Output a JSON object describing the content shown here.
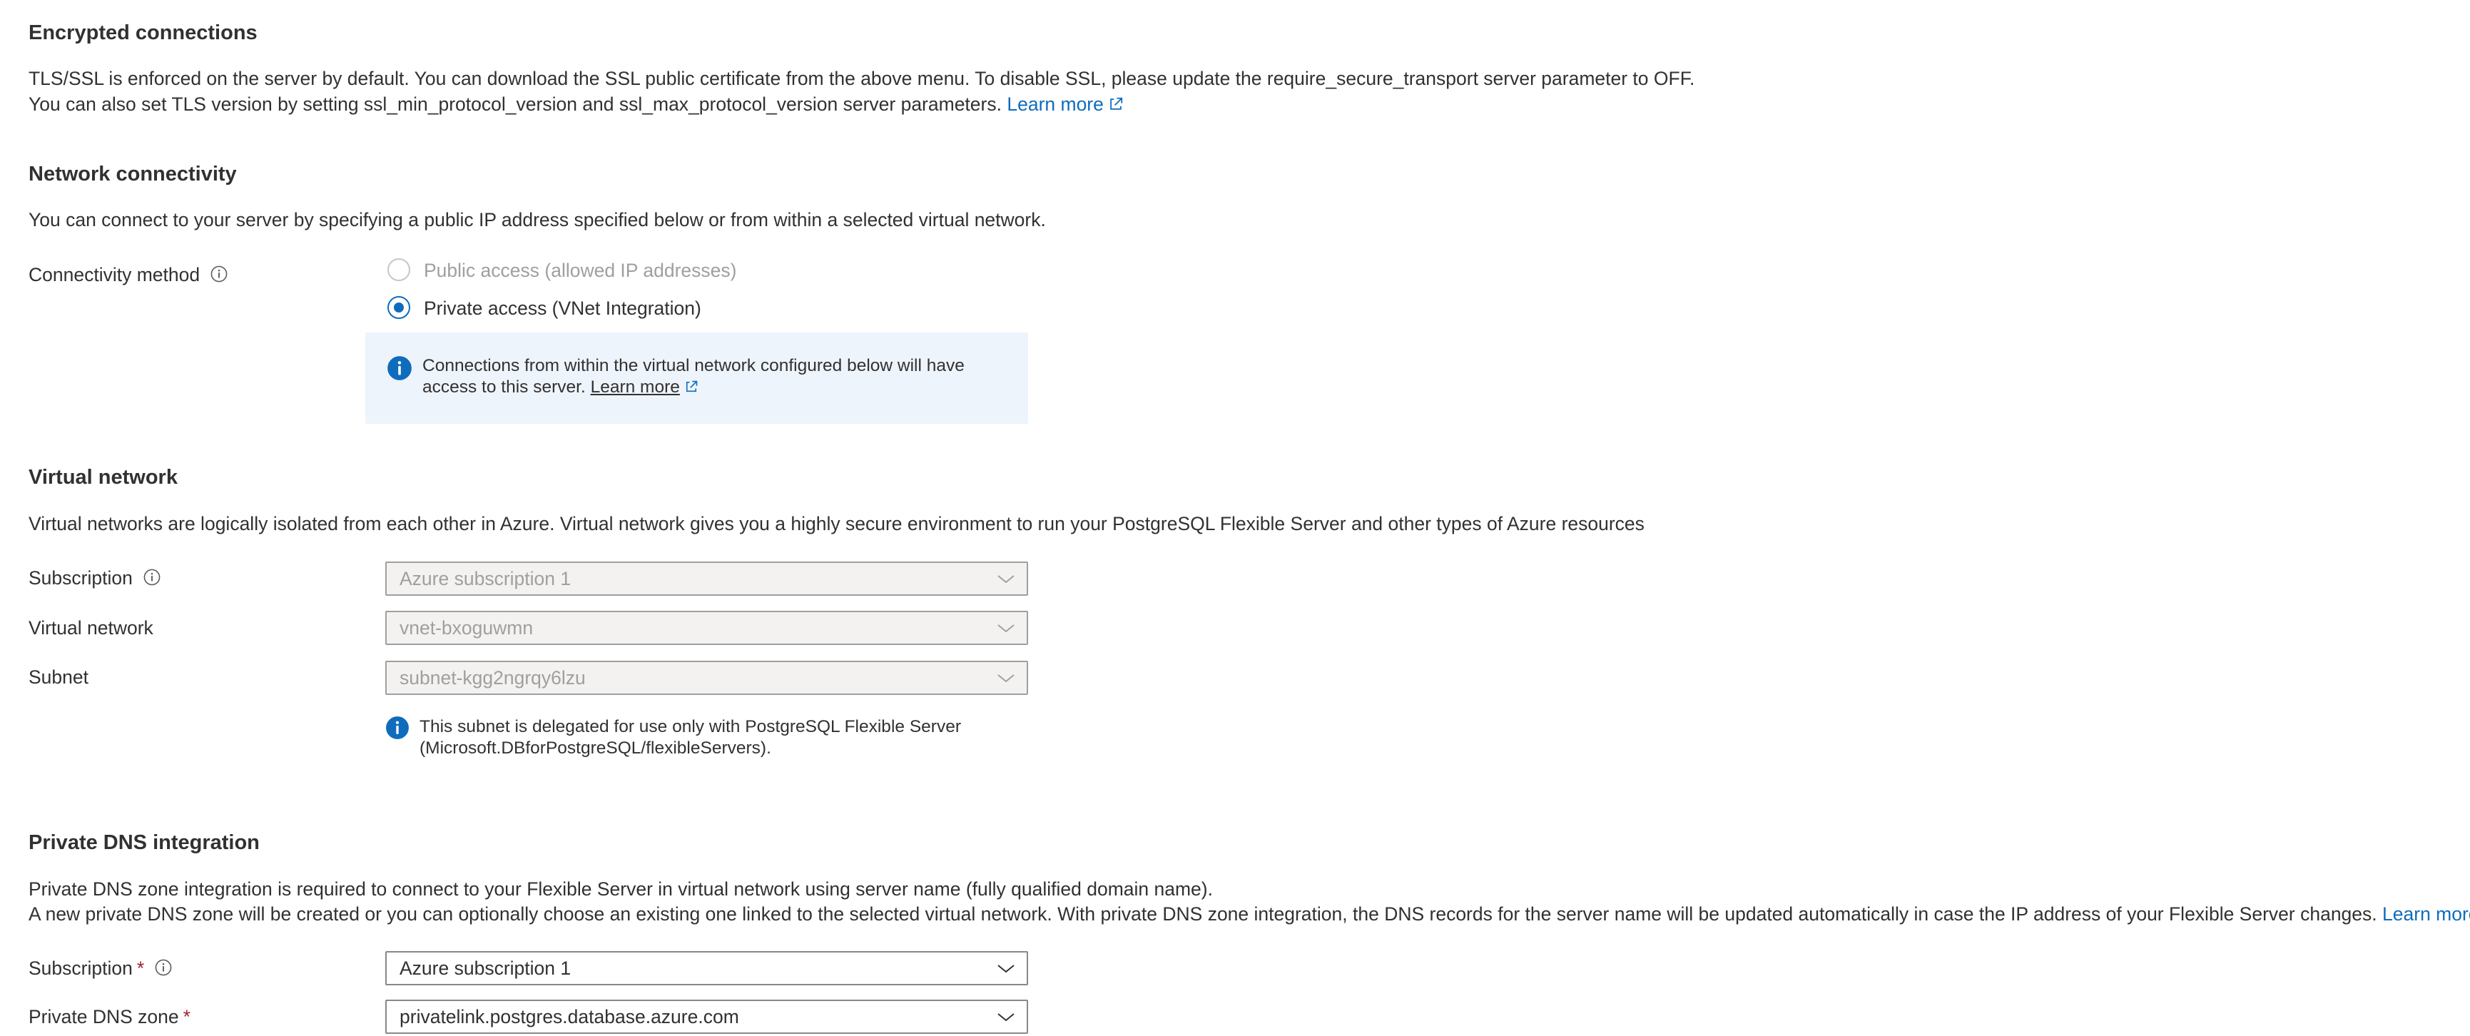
{
  "encrypted": {
    "heading": "Encrypted connections",
    "line1": "TLS/SSL is enforced on the server by default. You can download the SSL public certificate from the above menu. To disable SSL, please update the require_secure_transport server parameter to OFF.",
    "line2": "You can also set TLS version by setting ssl_min_protocol_version and ssl_max_protocol_version server parameters.",
    "learn_more": "Learn more"
  },
  "network": {
    "heading": "Network connectivity",
    "description": "You can connect to your server by specifying a public IP address specified below or from within a selected virtual network.",
    "method_label": "Connectivity method",
    "options": [
      {
        "label": "Public access (allowed IP addresses)",
        "selected": false,
        "disabled": true
      },
      {
        "label": "Private access (VNet Integration)",
        "selected": true,
        "disabled": false
      }
    ],
    "info_line1": "Connections from within the virtual network configured below will have",
    "info_line2": "access to this server.",
    "info_link": "Learn more"
  },
  "vnet": {
    "heading": "Virtual network",
    "description": "Virtual networks are logically isolated from each other in Azure. Virtual network gives you a highly secure environment to run your PostgreSQL Flexible Server and other types of Azure resources",
    "subscription_label": "Subscription",
    "subscription_value": "Azure subscription 1",
    "vnet_label": "Virtual network",
    "vnet_value": "vnet-bxoguwmn",
    "subnet_label": "Subnet",
    "subnet_value": "subnet-kgg2ngrqy6lzu",
    "subnet_info_line1": "This subnet is delegated for use only with PostgreSQL Flexible Server",
    "subnet_info_line2": "(Microsoft.DBforPostgreSQL/flexibleServers)."
  },
  "dns": {
    "heading": "Private DNS integration",
    "line1": "Private DNS zone integration is required to connect to your Flexible Server in virtual network using server name (fully qualified domain name).",
    "line2": "A new private DNS zone will be created or you can optionally choose an existing one linked to the selected virtual network. With private DNS zone integration, the DNS records for the server name will be updated automatically in case the IP address of your Flexible Server changes.",
    "learn_more": "Learn more",
    "subscription_label": "Subscription",
    "subscription_value": "Azure subscription 1",
    "zone_label": "Private DNS zone",
    "zone_value": "privatelink.postgres.database.azure.com",
    "required_marker": "*"
  },
  "colors": {
    "accent": "#0f6cbd",
    "info_bg": "#eef4fc",
    "required": "#a4262c"
  }
}
